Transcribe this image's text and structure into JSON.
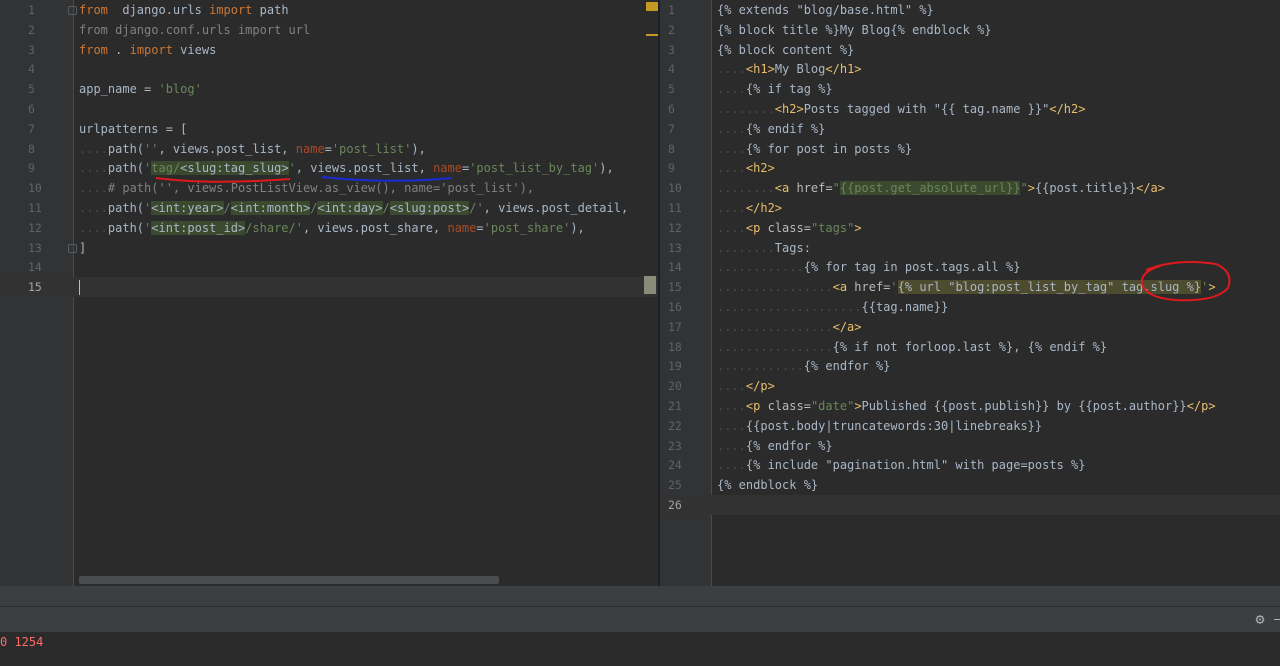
{
  "left_editor": {
    "lines": [
      {
        "n": "1",
        "parts": [
          [
            "kw",
            "from"
          ],
          [
            "",
            "  django.urls "
          ],
          [
            "kw",
            "import"
          ],
          [
            "",
            " path"
          ]
        ]
      },
      {
        "n": "2",
        "parts": [
          [
            "cm",
            "from django.conf.urls import url"
          ]
        ]
      },
      {
        "n": "3",
        "parts": [
          [
            "kw",
            "from"
          ],
          [
            "",
            " . "
          ],
          [
            "kw",
            "import"
          ],
          [
            "",
            " views"
          ]
        ]
      },
      {
        "n": "4",
        "parts": []
      },
      {
        "n": "5",
        "parts": [
          [
            "",
            "app_name = "
          ],
          [
            "str",
            "'blog'"
          ]
        ]
      },
      {
        "n": "6",
        "parts": []
      },
      {
        "n": "7",
        "parts": [
          [
            "",
            "urlpatterns = ["
          ]
        ]
      },
      {
        "n": "8",
        "parts": [
          [
            "ws",
            "...."
          ],
          [
            "",
            "path("
          ],
          [
            "str",
            "''"
          ],
          [
            "",
            ", views.post_list, "
          ],
          [
            "param",
            "name"
          ],
          [
            "",
            "="
          ],
          [
            "str",
            "'post_list'"
          ],
          [
            "",
            "),"
          ]
        ]
      },
      {
        "n": "9",
        "parts": [
          [
            "ws",
            "...."
          ],
          [
            "",
            "path("
          ],
          [
            "str",
            "'"
          ],
          [
            "str hl",
            "tag/"
          ],
          [
            "hl",
            "<slug:tag_slug>"
          ],
          [
            "str",
            "'"
          ],
          [
            "",
            ", views.post_list, "
          ],
          [
            "param",
            "name"
          ],
          [
            "",
            "="
          ],
          [
            "str",
            "'post_list_by_tag'"
          ],
          [
            "",
            "),"
          ]
        ]
      },
      {
        "n": "10",
        "parts": [
          [
            "ws",
            "...."
          ],
          [
            "cm",
            "# path('', views.PostListView.as_view(), name='post_list'),"
          ]
        ]
      },
      {
        "n": "11",
        "parts": [
          [
            "ws",
            "...."
          ],
          [
            "",
            "path("
          ],
          [
            "str",
            "'"
          ],
          [
            "hl",
            "<int:year>"
          ],
          [
            "str",
            "/"
          ],
          [
            "hl",
            "<int:month>"
          ],
          [
            "str",
            "/"
          ],
          [
            "hl",
            "<int:day>"
          ],
          [
            "str",
            "/"
          ],
          [
            "hl",
            "<slug:post>"
          ],
          [
            "str",
            "/'"
          ],
          [
            "",
            ", views.post_detail,"
          ]
        ]
      },
      {
        "n": "12",
        "parts": [
          [
            "ws",
            "...."
          ],
          [
            "",
            "path("
          ],
          [
            "str",
            "'"
          ],
          [
            "hl",
            "<int:post_id>"
          ],
          [
            "str",
            "/share/'"
          ],
          [
            "",
            ", views.post_share, "
          ],
          [
            "param",
            "name"
          ],
          [
            "",
            "="
          ],
          [
            "str",
            "'post_share'"
          ],
          [
            "",
            "),"
          ]
        ]
      },
      {
        "n": "13",
        "parts": [
          [
            "",
            "]"
          ]
        ]
      },
      {
        "n": "14",
        "parts": []
      },
      {
        "n": "15",
        "parts": [],
        "current": true
      }
    ]
  },
  "right_editor": {
    "lines": [
      {
        "n": "1",
        "parts": [
          [
            "",
            "{% extends \"blog/base.html\" %}"
          ]
        ]
      },
      {
        "n": "2",
        "parts": [
          [
            "",
            "{% block title %}My Blog{% endblock %}"
          ]
        ]
      },
      {
        "n": "3",
        "parts": [
          [
            "",
            "{% block content %}"
          ]
        ]
      },
      {
        "n": "4",
        "parts": [
          [
            "ws",
            "...."
          ],
          [
            "tag",
            "<h1>"
          ],
          [
            "",
            "My Blog"
          ],
          [
            "tag",
            "</h1>"
          ]
        ]
      },
      {
        "n": "5",
        "parts": [
          [
            "ws",
            "...."
          ],
          [
            "",
            "{% if tag %}"
          ]
        ]
      },
      {
        "n": "6",
        "parts": [
          [
            "ws",
            "........"
          ],
          [
            "tag",
            "<h2>"
          ],
          [
            "",
            "Posts tagged with \"{{ tag.name }}\""
          ],
          [
            "tag",
            "</h2>"
          ]
        ]
      },
      {
        "n": "7",
        "parts": [
          [
            "ws",
            "...."
          ],
          [
            "",
            "{% endif %}"
          ]
        ]
      },
      {
        "n": "8",
        "parts": [
          [
            "ws",
            "...."
          ],
          [
            "",
            "{% for post in posts %}"
          ]
        ]
      },
      {
        "n": "9",
        "parts": [
          [
            "ws",
            "...."
          ],
          [
            "tag",
            "<h2>"
          ]
        ]
      },
      {
        "n": "10",
        "parts": [
          [
            "ws",
            "........"
          ],
          [
            "tag",
            "<a "
          ],
          [
            "attr",
            "href="
          ],
          [
            "str",
            "\""
          ],
          [
            "str hl",
            "{{post.get_absolute_url}}"
          ],
          [
            "str",
            "\""
          ],
          [
            "tag",
            ">"
          ],
          [
            "",
            "{{post.title}}"
          ],
          [
            "tag",
            "</a>"
          ]
        ]
      },
      {
        "n": "11",
        "parts": [
          [
            "ws",
            "...."
          ],
          [
            "tag",
            "</h2>"
          ]
        ]
      },
      {
        "n": "12",
        "parts": [
          [
            "ws",
            "...."
          ],
          [
            "tag",
            "<p "
          ],
          [
            "attr",
            "class="
          ],
          [
            "str",
            "\"tags\""
          ],
          [
            "tag",
            ">"
          ]
        ]
      },
      {
        "n": "13",
        "parts": [
          [
            "ws",
            "........"
          ],
          [
            "",
            "Tags:"
          ]
        ]
      },
      {
        "n": "14",
        "parts": [
          [
            "ws",
            "............"
          ],
          [
            "",
            "{% for tag in post.tags.all %}"
          ]
        ]
      },
      {
        "n": "15",
        "parts": [
          [
            "ws",
            "................"
          ],
          [
            "tag",
            "<a "
          ],
          [
            "attr",
            "href="
          ],
          [
            "str",
            "'"
          ],
          [
            "hl2",
            "{% url \"blog:post_list_by_tag\" tag.slug %}"
          ],
          [
            "str",
            "'"
          ],
          [
            "tag",
            ">"
          ]
        ]
      },
      {
        "n": "16",
        "parts": [
          [
            "ws",
            "...................."
          ],
          [
            "",
            "{{tag.name}}"
          ]
        ]
      },
      {
        "n": "17",
        "parts": [
          [
            "ws",
            "................"
          ],
          [
            "tag",
            "</a>"
          ]
        ]
      },
      {
        "n": "18",
        "parts": [
          [
            "ws",
            "................"
          ],
          [
            "",
            "{% if not forloop.last %}, {% endif %}"
          ]
        ]
      },
      {
        "n": "19",
        "parts": [
          [
            "ws",
            "............"
          ],
          [
            "",
            "{% endfor %}"
          ]
        ]
      },
      {
        "n": "20",
        "parts": [
          [
            "ws",
            "...."
          ],
          [
            "tag",
            "</p>"
          ]
        ]
      },
      {
        "n": "21",
        "parts": [
          [
            "ws",
            "...."
          ],
          [
            "tag",
            "<p "
          ],
          [
            "attr",
            "class="
          ],
          [
            "str",
            "\"date\""
          ],
          [
            "tag",
            ">"
          ],
          [
            "",
            "Published {{post.publish}} by {{post.author}}"
          ],
          [
            "tag",
            "</p>"
          ]
        ]
      },
      {
        "n": "22",
        "parts": [
          [
            "ws",
            "...."
          ],
          [
            "",
            "{{post.body|truncatewords:30|linebreaks}}"
          ]
        ]
      },
      {
        "n": "23",
        "parts": [
          [
            "ws",
            "...."
          ],
          [
            "",
            "{% endfor %}"
          ]
        ]
      },
      {
        "n": "24",
        "parts": [
          [
            "ws",
            "...."
          ],
          [
            "",
            "{% include \"pagination.html\" with page=posts %}"
          ]
        ]
      },
      {
        "n": "25",
        "parts": [
          [
            "",
            "{% endblock %}"
          ]
        ]
      },
      {
        "n": "26",
        "parts": [],
        "current": true
      }
    ]
  },
  "status": {
    "bottom_text": "0 1254",
    "settings_icon": "gear-icon"
  },
  "colors": {
    "background": "#2b2b2b",
    "keyword": "#cc7832",
    "string": "#6a8759",
    "comment": "#808080",
    "html_tag": "#e8bf6a",
    "annotation_red": "#e0191d",
    "annotation_blue": "#1a2bd8"
  }
}
